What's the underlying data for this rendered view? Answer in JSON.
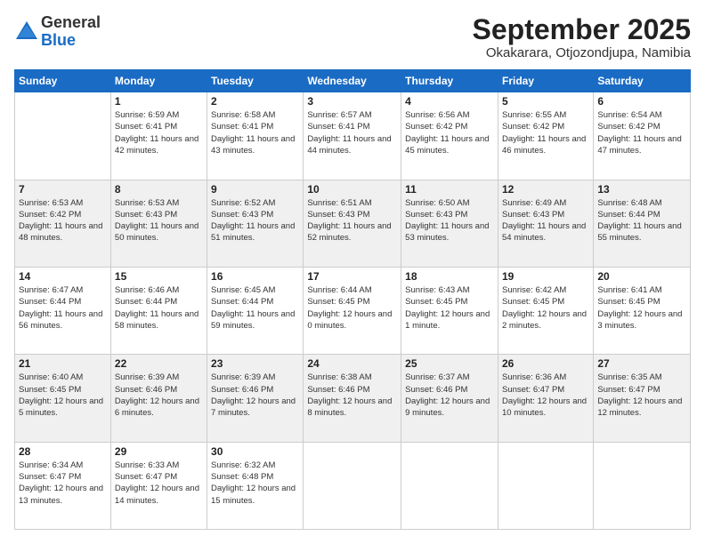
{
  "header": {
    "logo_line1": "General",
    "logo_line2": "Blue",
    "month": "September 2025",
    "location": "Okakarara, Otjozondjupa, Namibia"
  },
  "days_of_week": [
    "Sunday",
    "Monday",
    "Tuesday",
    "Wednesday",
    "Thursday",
    "Friday",
    "Saturday"
  ],
  "weeks": [
    [
      {
        "day": "",
        "sunrise": "",
        "sunset": "",
        "daylight": ""
      },
      {
        "day": "1",
        "sunrise": "Sunrise: 6:59 AM",
        "sunset": "Sunset: 6:41 PM",
        "daylight": "Daylight: 11 hours and 42 minutes."
      },
      {
        "day": "2",
        "sunrise": "Sunrise: 6:58 AM",
        "sunset": "Sunset: 6:41 PM",
        "daylight": "Daylight: 11 hours and 43 minutes."
      },
      {
        "day": "3",
        "sunrise": "Sunrise: 6:57 AM",
        "sunset": "Sunset: 6:41 PM",
        "daylight": "Daylight: 11 hours and 44 minutes."
      },
      {
        "day": "4",
        "sunrise": "Sunrise: 6:56 AM",
        "sunset": "Sunset: 6:42 PM",
        "daylight": "Daylight: 11 hours and 45 minutes."
      },
      {
        "day": "5",
        "sunrise": "Sunrise: 6:55 AM",
        "sunset": "Sunset: 6:42 PM",
        "daylight": "Daylight: 11 hours and 46 minutes."
      },
      {
        "day": "6",
        "sunrise": "Sunrise: 6:54 AM",
        "sunset": "Sunset: 6:42 PM",
        "daylight": "Daylight: 11 hours and 47 minutes."
      }
    ],
    [
      {
        "day": "7",
        "sunrise": "Sunrise: 6:53 AM",
        "sunset": "Sunset: 6:42 PM",
        "daylight": "Daylight: 11 hours and 48 minutes."
      },
      {
        "day": "8",
        "sunrise": "Sunrise: 6:53 AM",
        "sunset": "Sunset: 6:43 PM",
        "daylight": "Daylight: 11 hours and 50 minutes."
      },
      {
        "day": "9",
        "sunrise": "Sunrise: 6:52 AM",
        "sunset": "Sunset: 6:43 PM",
        "daylight": "Daylight: 11 hours and 51 minutes."
      },
      {
        "day": "10",
        "sunrise": "Sunrise: 6:51 AM",
        "sunset": "Sunset: 6:43 PM",
        "daylight": "Daylight: 11 hours and 52 minutes."
      },
      {
        "day": "11",
        "sunrise": "Sunrise: 6:50 AM",
        "sunset": "Sunset: 6:43 PM",
        "daylight": "Daylight: 11 hours and 53 minutes."
      },
      {
        "day": "12",
        "sunrise": "Sunrise: 6:49 AM",
        "sunset": "Sunset: 6:43 PM",
        "daylight": "Daylight: 11 hours and 54 minutes."
      },
      {
        "day": "13",
        "sunrise": "Sunrise: 6:48 AM",
        "sunset": "Sunset: 6:44 PM",
        "daylight": "Daylight: 11 hours and 55 minutes."
      }
    ],
    [
      {
        "day": "14",
        "sunrise": "Sunrise: 6:47 AM",
        "sunset": "Sunset: 6:44 PM",
        "daylight": "Daylight: 11 hours and 56 minutes."
      },
      {
        "day": "15",
        "sunrise": "Sunrise: 6:46 AM",
        "sunset": "Sunset: 6:44 PM",
        "daylight": "Daylight: 11 hours and 58 minutes."
      },
      {
        "day": "16",
        "sunrise": "Sunrise: 6:45 AM",
        "sunset": "Sunset: 6:44 PM",
        "daylight": "Daylight: 11 hours and 59 minutes."
      },
      {
        "day": "17",
        "sunrise": "Sunrise: 6:44 AM",
        "sunset": "Sunset: 6:45 PM",
        "daylight": "Daylight: 12 hours and 0 minutes."
      },
      {
        "day": "18",
        "sunrise": "Sunrise: 6:43 AM",
        "sunset": "Sunset: 6:45 PM",
        "daylight": "Daylight: 12 hours and 1 minute."
      },
      {
        "day": "19",
        "sunrise": "Sunrise: 6:42 AM",
        "sunset": "Sunset: 6:45 PM",
        "daylight": "Daylight: 12 hours and 2 minutes."
      },
      {
        "day": "20",
        "sunrise": "Sunrise: 6:41 AM",
        "sunset": "Sunset: 6:45 PM",
        "daylight": "Daylight: 12 hours and 3 minutes."
      }
    ],
    [
      {
        "day": "21",
        "sunrise": "Sunrise: 6:40 AM",
        "sunset": "Sunset: 6:45 PM",
        "daylight": "Daylight: 12 hours and 5 minutes."
      },
      {
        "day": "22",
        "sunrise": "Sunrise: 6:39 AM",
        "sunset": "Sunset: 6:46 PM",
        "daylight": "Daylight: 12 hours and 6 minutes."
      },
      {
        "day": "23",
        "sunrise": "Sunrise: 6:39 AM",
        "sunset": "Sunset: 6:46 PM",
        "daylight": "Daylight: 12 hours and 7 minutes."
      },
      {
        "day": "24",
        "sunrise": "Sunrise: 6:38 AM",
        "sunset": "Sunset: 6:46 PM",
        "daylight": "Daylight: 12 hours and 8 minutes."
      },
      {
        "day": "25",
        "sunrise": "Sunrise: 6:37 AM",
        "sunset": "Sunset: 6:46 PM",
        "daylight": "Daylight: 12 hours and 9 minutes."
      },
      {
        "day": "26",
        "sunrise": "Sunrise: 6:36 AM",
        "sunset": "Sunset: 6:47 PM",
        "daylight": "Daylight: 12 hours and 10 minutes."
      },
      {
        "day": "27",
        "sunrise": "Sunrise: 6:35 AM",
        "sunset": "Sunset: 6:47 PM",
        "daylight": "Daylight: 12 hours and 12 minutes."
      }
    ],
    [
      {
        "day": "28",
        "sunrise": "Sunrise: 6:34 AM",
        "sunset": "Sunset: 6:47 PM",
        "daylight": "Daylight: 12 hours and 13 minutes."
      },
      {
        "day": "29",
        "sunrise": "Sunrise: 6:33 AM",
        "sunset": "Sunset: 6:47 PM",
        "daylight": "Daylight: 12 hours and 14 minutes."
      },
      {
        "day": "30",
        "sunrise": "Sunrise: 6:32 AM",
        "sunset": "Sunset: 6:48 PM",
        "daylight": "Daylight: 12 hours and 15 minutes."
      },
      {
        "day": "",
        "sunrise": "",
        "sunset": "",
        "daylight": ""
      },
      {
        "day": "",
        "sunrise": "",
        "sunset": "",
        "daylight": ""
      },
      {
        "day": "",
        "sunrise": "",
        "sunset": "",
        "daylight": ""
      },
      {
        "day": "",
        "sunrise": "",
        "sunset": "",
        "daylight": ""
      }
    ]
  ]
}
